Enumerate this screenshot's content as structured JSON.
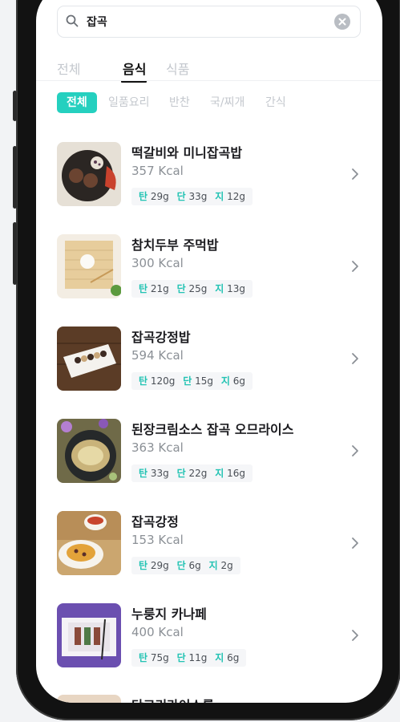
{
  "search": {
    "value": "잡곡"
  },
  "main_tabs": [
    "전체",
    "음식",
    "식품"
  ],
  "sub_tabs": [
    "전체",
    "일품요리",
    "반찬",
    "국/찌개",
    "간식"
  ],
  "macro_labels": {
    "carb": "탄",
    "protein": "단",
    "fat": "지"
  },
  "foods": [
    {
      "name": "떡갈비와 미니잡곡밥",
      "kcal": "357 Kcal",
      "carb": "29g",
      "protein": "33g",
      "fat": "12g"
    },
    {
      "name": "참치두부 주먹밥",
      "kcal": "300 Kcal",
      "carb": "21g",
      "protein": "25g",
      "fat": "13g"
    },
    {
      "name": "잡곡강정밥",
      "kcal": "594 Kcal",
      "carb": "120g",
      "protein": "15g",
      "fat": "6g"
    },
    {
      "name": "된장크림소스 잡곡 오므라이스",
      "kcal": "363 Kcal",
      "carb": "33g",
      "protein": "22g",
      "fat": "16g"
    },
    {
      "name": "잡곡강정",
      "kcal": "153 Kcal",
      "carb": "29g",
      "protein": "6g",
      "fat": "2g"
    },
    {
      "name": "누룽지 카나페",
      "kcal": "400 Kcal",
      "carb": "75g",
      "protein": "11g",
      "fat": "6g"
    }
  ],
  "partial_item": {
    "name": "단고리라이스롤"
  },
  "colors": {
    "accent": "#25d0bf",
    "macro_label": "#22c3b3"
  }
}
